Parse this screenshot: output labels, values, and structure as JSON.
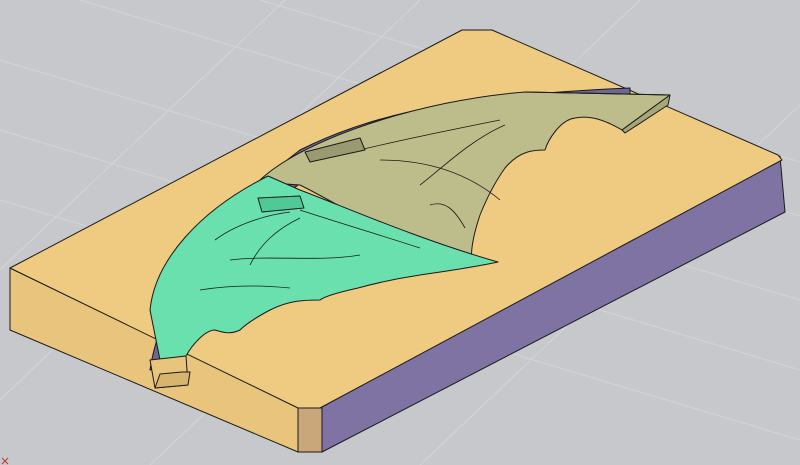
{
  "viewport": {
    "background": "#c6c8cb",
    "grid_color": "#d6d7d9"
  },
  "model": {
    "block_top_color": "#eecb80",
    "block_front_color": "#e8c47c",
    "block_side_color": "#7e73a2",
    "block_corner_color": "#c9a77a",
    "cavity_color": "#6f6693",
    "wing_near_color": "#69e0ae",
    "wing_far_color": "#bdbd8c"
  },
  "ucs": {
    "icon": "ucs-axis-icon",
    "color": "#c0392b"
  }
}
